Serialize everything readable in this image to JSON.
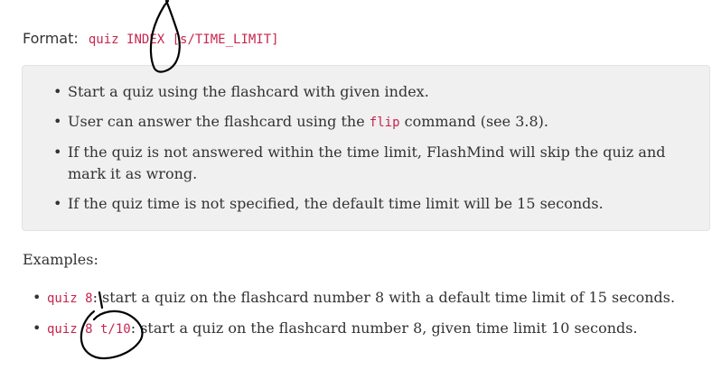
{
  "format": {
    "label": "Format:",
    "command": "quiz INDEX [s/TIME_LIMIT]"
  },
  "notes": [
    "Start a quiz using the flashcard with given index.",
    {
      "before": "User can answer the flashcard using the ",
      "code": "flip",
      "after": " command (see 3.8)."
    },
    "If the quiz is not answered within the time limit, FlashMind will skip the quiz and mark it as wrong.",
    "If the quiz time is not specified, the default time limit will be 15 seconds."
  ],
  "examples": {
    "title": "Examples:",
    "items": [
      {
        "code": "quiz 8",
        "text": ": start a quiz on the flashcard number 8 with a default time limit of 15 seconds."
      },
      {
        "code": "quiz 8 t/10",
        "text": ": start a quiz on the flashcard number 8, given time limit 10 seconds."
      }
    ]
  },
  "colors": {
    "code": "#c7254e",
    "text": "#333333",
    "note_background": "#f0f0f0",
    "ink": "#000000"
  }
}
